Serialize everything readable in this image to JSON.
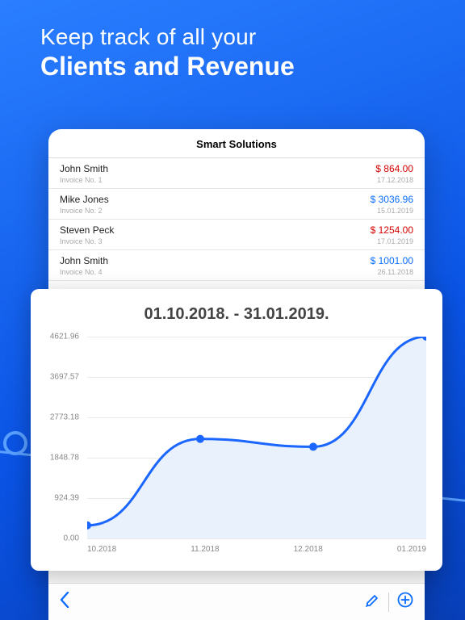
{
  "hero": {
    "line1": "Keep track of all your",
    "line2": "Clients and Revenue"
  },
  "header": {
    "title": "Smart Solutions"
  },
  "invoices": [
    {
      "name": "John Smith",
      "sub": "Invoice No. 1",
      "amount": "$ 864.00",
      "date": "17.12.2018",
      "color": "red"
    },
    {
      "name": "Mike Jones",
      "sub": "Invoice No. 2",
      "amount": "$ 3036.96",
      "date": "15.01.2019",
      "color": "blue"
    },
    {
      "name": "Steven Peck",
      "sub": "Invoice No. 3",
      "amount": "$ 1254.00",
      "date": "17.01.2019",
      "color": "red"
    },
    {
      "name": "John Smith",
      "sub": "Invoice No. 4",
      "amount": "$ 1001.00",
      "date": "26.11.2018",
      "color": "blue"
    }
  ],
  "chart_data": {
    "type": "area",
    "title": "01.10.2018. - 31.01.2019.",
    "x": [
      "10.2018",
      "11.2018",
      "12.2018",
      "01.2019"
    ],
    "values": [
      300,
      2280,
      2100,
      4621.96
    ],
    "y_ticks": [
      "4621.96",
      "3697.57",
      "2773.18",
      "1848.78",
      "924.39",
      "0.00"
    ],
    "ylim": [
      0,
      4621.96
    ],
    "xlabel": "",
    "ylabel": ""
  },
  "colors": {
    "accent_blue": "#1a66ff",
    "amount_red": "#d40000",
    "amount_blue": "#0a6cff"
  }
}
